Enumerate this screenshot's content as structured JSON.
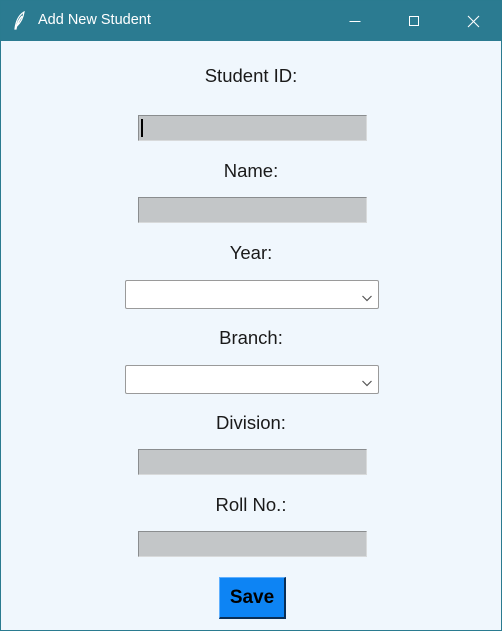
{
  "window": {
    "title": "Add New Student",
    "app_icon": "feather-icon",
    "controls": {
      "minimize_icon": "minimize-icon",
      "maximize_icon": "maximize-icon",
      "close_icon": "close-icon"
    },
    "titlebar_color": "#2b7b91",
    "background_color": "#f0f7fd"
  },
  "form": {
    "student_id": {
      "label": "Student ID:",
      "value": ""
    },
    "name": {
      "label": "Name:",
      "value": ""
    },
    "year": {
      "label": "Year:",
      "selected": "",
      "arrow_icon": "chevron-down-icon"
    },
    "branch": {
      "label": "Branch:",
      "selected": "",
      "arrow_icon": "chevron-down-icon"
    },
    "division": {
      "label": "Division:",
      "value": ""
    },
    "roll_no": {
      "label": "Roll No.:",
      "value": ""
    },
    "save_label": "Save",
    "save_color": "#0d84f4",
    "entry_color": "#c3c6c8"
  }
}
